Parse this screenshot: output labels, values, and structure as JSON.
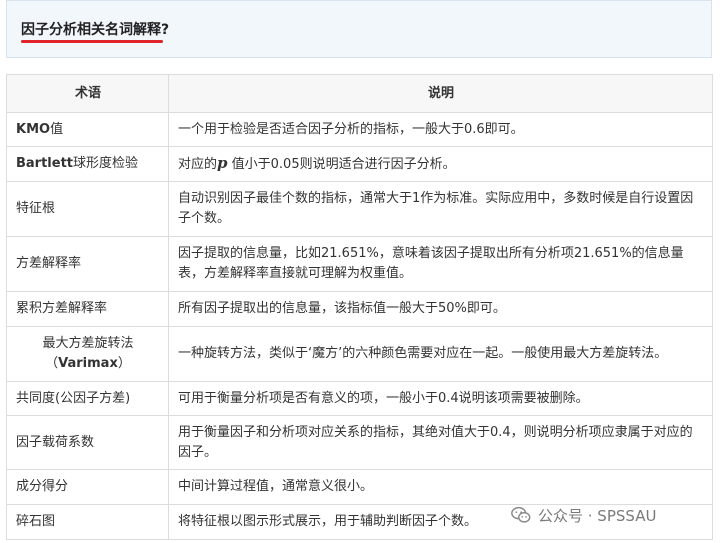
{
  "header": {
    "title": "因子分析相关名词解释?"
  },
  "table": {
    "columns": [
      "术语",
      "说明"
    ],
    "rows": [
      {
        "term": "KMO值",
        "term_bold": "KMO",
        "term_rest": "值",
        "desc": "一个用于检验是否适合因子分析的指标，一般大于0.6即可。"
      },
      {
        "term_bold": "Bartlett",
        "term_rest": "球形度检验",
        "desc_pre": "对应的",
        "desc_p": "p",
        "desc_post": " 值小于0.05则说明适合进行因子分析。"
      },
      {
        "term": "特征根",
        "desc": "自动识别因子最佳个数的指标，通常大于1作为标准。实际应用中，多数时候是自行设置因子个数。"
      },
      {
        "term": "方差解释率",
        "desc": "因子提取的信息量，比如21.651%，意味着该因子提取出所有分析项21.651%的信息量表，方差解释率直接就可理解为权重值。"
      },
      {
        "term": "累积方差解释率",
        "desc": "所有因子提取出的信息量，该指标值一般大于50%即可。"
      },
      {
        "term_line1": "最大方差旋转法",
        "term_line2_pre": "（",
        "term_line2_bold": "Varimax",
        "term_line2_post": "）",
        "desc": "一种旋转方法，类似于‘魔方’的六种颜色需要对应在一起。一般使用最大方差旋转法。"
      },
      {
        "term": "共同度(公因子方差)",
        "desc": "可用于衡量分析项是否有意义的项，一般小于0.4说明该项需要被删除。"
      },
      {
        "term": "因子载荷系数",
        "desc": "用于衡量因子和分析项对应关系的指标，其绝对值大于0.4，则说明分析项应隶属于对应的因子。"
      },
      {
        "term": "成分得分",
        "desc": "中间计算过程值，通常意义很小。"
      },
      {
        "term": "碎石图",
        "desc": "将特征根以图示形式展示，用于辅助判断因子个数。"
      }
    ]
  },
  "watermark": {
    "text": "公众号 · SPSSAU",
    "icon": "wechat-icon"
  }
}
